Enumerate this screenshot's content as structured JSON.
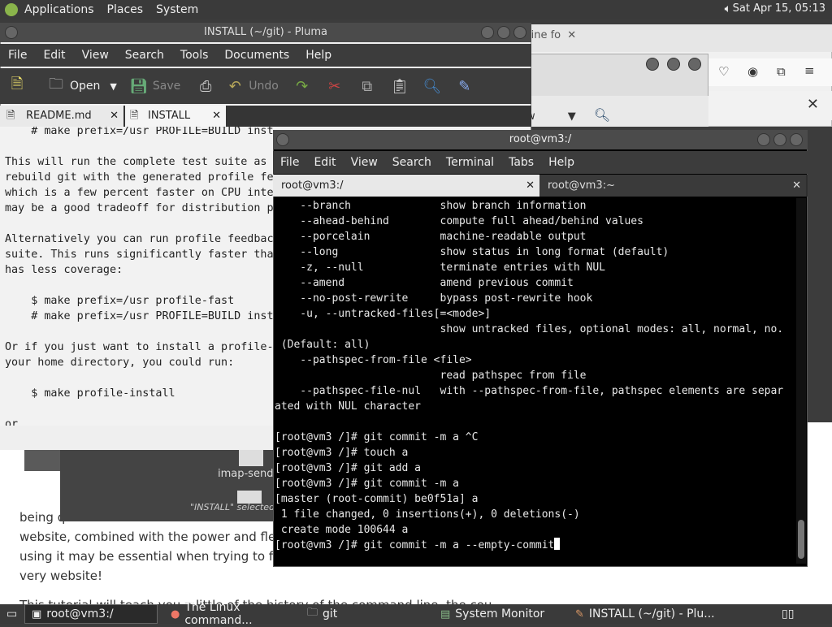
{
  "top_panel": {
    "menus": [
      "Applications",
      "Places",
      "System"
    ],
    "clock": "Sat Apr 15, 05:13",
    "volume_icon": "speaker-icon"
  },
  "browser": {
    "tab_label": "line fo",
    "tab_close": "✕",
    "web_text": [
      "being q",
      "website, combined with the power and flex",
      "using it may be essential when trying to foll",
      "very website!",
      "This tutorial will teach you a little of the history of the command line, the cou"
    ]
  },
  "mid_window": {
    "partial_label": "w"
  },
  "file_manager": {
    "file_label": "imap-send",
    "status": "\"INSTALL\" selected",
    "partial_label": "P"
  },
  "pluma": {
    "title": "INSTALL (~/git) - Pluma",
    "menu": [
      "File",
      "Edit",
      "View",
      "Search",
      "Tools",
      "Documents",
      "Help"
    ],
    "toolbar": {
      "open": "Open",
      "save": "Save",
      "undo": "Undo"
    },
    "tabs": [
      {
        "label": "README.md"
      },
      {
        "label": "INSTALL"
      }
    ],
    "text": "    # make prefix=/usr PROFILE=BUILD inst\n\nThis will run the complete test suite as\nrebuild git with the generated profile fe\nwhich is a few percent faster on CPU inte\nmay be a good tradeoff for distribution p\n\nAlternatively you can run profile feedbac\nsuite. This runs significantly faster tha\nhas less coverage:\n\n    $ make prefix=/usr profile-fast\n    # make prefix=/usr PROFILE=BUILD inst\n\nOr if you just want to install a profile-\nyour home directory, you could run:\n\n    $ make profile-install\n\nor"
  },
  "terminal": {
    "title": "root@vm3:/",
    "menu": [
      "File",
      "Edit",
      "View",
      "Search",
      "Terminal",
      "Tabs",
      "Help"
    ],
    "tabs": [
      {
        "label": "root@vm3:/"
      },
      {
        "label": "root@vm3:~"
      }
    ],
    "text": "    --branch              show branch information\n    --ahead-behind        compute full ahead/behind values\n    --porcelain           machine-readable output\n    --long                show status in long format (default)\n    -z, --null            terminate entries with NUL\n    --amend               amend previous commit\n    --no-post-rewrite     bypass post-rewrite hook\n    -u, --untracked-files[=<mode>]\n                          show untracked files, optional modes: all, normal, no.\n (Default: all)\n    --pathspec-from-file <file>\n                          read pathspec from file\n    --pathspec-file-nul   with --pathspec-from-file, pathspec elements are separ\nated with NUL character\n\n[root@vm3 /]# git commit -m a ^C\n[root@vm3 /]# touch a\n[root@vm3 /]# git add a\n[root@vm3 /]# git commit -m a\n[master (root-commit) be0f51a] a\n 1 file changed, 0 insertions(+), 0 deletions(-)\n create mode 100644 a\n",
    "prompt_line": "[root@vm3 /]# git commit -m a --empty-commit"
  },
  "taskbar": {
    "items": [
      {
        "label": "root@vm3:/",
        "icon": "terminal-icon"
      },
      {
        "label": "The Linux command...",
        "icon": "firefox-icon"
      },
      {
        "label": "git",
        "icon": "folder-icon"
      },
      {
        "label": "System Monitor",
        "icon": "monitor-icon"
      },
      {
        "label": "INSTALL (~/git) - Plu...",
        "icon": "text-editor-icon"
      }
    ]
  }
}
